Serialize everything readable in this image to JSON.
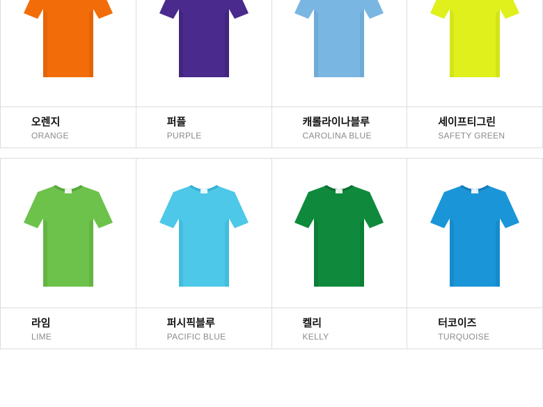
{
  "rows": [
    [
      {
        "ko": "오렌지",
        "en": "ORANGE",
        "color": "#f26d0a",
        "shade": "#d85c05"
      },
      {
        "ko": "퍼플",
        "en": "PURPLE",
        "color": "#4a2a8c",
        "shade": "#3a1f72"
      },
      {
        "ko": "캐롤라이나블루",
        "en": "CAROLINA BLUE",
        "color": "#7ab6e2",
        "shade": "#649fcc"
      },
      {
        "ko": "세이프티그린",
        "en": "SAFETY GREEN",
        "color": "#dff01c",
        "shade": "#c8d910"
      }
    ],
    [
      {
        "ko": "라임",
        "en": "LIME",
        "color": "#6cc24a",
        "shade": "#57a83a"
      },
      {
        "ko": "퍼시픽블루",
        "en": "PACIFIC BLUE",
        "color": "#4ec8e8",
        "shade": "#38b2d4"
      },
      {
        "ko": "켈리",
        "en": "KELLY",
        "color": "#0f8a3c",
        "shade": "#0a7230"
      },
      {
        "ko": "터코이즈",
        "en": "TURQUOISE",
        "color": "#1a96d8",
        "shade": "#127fbf"
      }
    ]
  ]
}
